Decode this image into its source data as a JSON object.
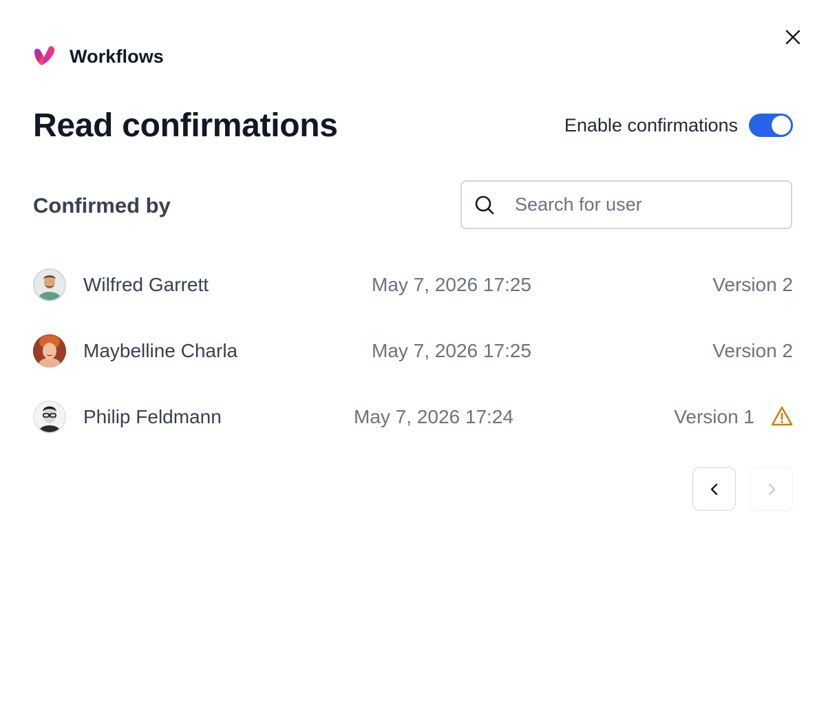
{
  "app": {
    "title": "Workflows",
    "logo_icon": "workflows-heart-logo",
    "close_icon": "close-icon"
  },
  "page": {
    "title": "Read confirmations"
  },
  "toggle": {
    "label": "Enable confirmations",
    "enabled": true,
    "color": "#2563eb"
  },
  "section": {
    "title": "Confirmed by"
  },
  "search": {
    "placeholder": "Search for user",
    "value": "",
    "icon": "search-icon"
  },
  "confirmations": [
    {
      "name": "Wilfred Garrett",
      "date": "May 7, 2026 17:25",
      "version": "Version 2",
      "warning": false
    },
    {
      "name": "Maybelline Charla",
      "date": "May 7, 2026 17:25",
      "version": "Version 2",
      "warning": false
    },
    {
      "name": "Philip Feldmann",
      "date": "May 7, 2026 17:24",
      "version": "Version 1",
      "warning": true,
      "warning_color": "#d97706"
    }
  ],
  "pagination": {
    "prev_icon": "chevron-left-icon",
    "next_icon": "chevron-right-icon",
    "prev_enabled": true,
    "next_enabled": false
  }
}
